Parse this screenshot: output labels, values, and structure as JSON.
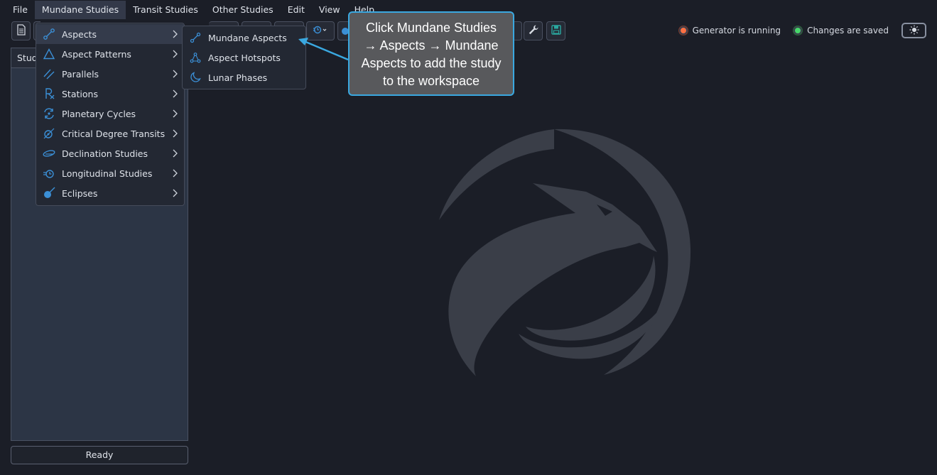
{
  "menubar": {
    "items": [
      {
        "label": "File"
      },
      {
        "label": "Mundane Studies"
      },
      {
        "label": "Transit Studies"
      },
      {
        "label": "Other Studies"
      },
      {
        "label": "Edit"
      },
      {
        "label": "View"
      },
      {
        "label": "Help"
      }
    ]
  },
  "toolbar": {
    "buttons": [
      {
        "icon": "document-icon"
      },
      {
        "icon": "wrench-icon"
      },
      {
        "icon": "save-icon"
      },
      {
        "icon": "longitudinal-icon"
      }
    ]
  },
  "status": {
    "generator": {
      "label": "Generator is running",
      "color": "#ff7043"
    },
    "saved": {
      "label": "Changes are saved",
      "color": "#47d76a"
    },
    "theme_icon": "sun-icon"
  },
  "left_panel": {
    "header": "Stud"
  },
  "ready": {
    "label": "Ready"
  },
  "dropdown": {
    "items": [
      {
        "label": "Aspects",
        "icon": "aspects-icon"
      },
      {
        "label": "Aspect Patterns",
        "icon": "triangle-icon"
      },
      {
        "label": "Parallels",
        "icon": "parallels-icon"
      },
      {
        "label": "Stations",
        "icon": "stations-icon"
      },
      {
        "label": "Planetary Cycles",
        "icon": "cycles-icon"
      },
      {
        "label": "Critical Degree Transits",
        "icon": "critical-degree-icon"
      },
      {
        "label": "Declination Studies",
        "icon": "declination-icon"
      },
      {
        "label": "Longitudinal Studies",
        "icon": "longitudinal-icon"
      },
      {
        "label": "Eclipses",
        "icon": "eclipse-icon"
      }
    ]
  },
  "submenu": {
    "items": [
      {
        "label": "Mundane Aspects",
        "icon": "aspects-icon"
      },
      {
        "label": "Aspect Hotspots",
        "icon": "hotspots-icon"
      },
      {
        "label": "Lunar Phases",
        "icon": "moon-icon"
      }
    ]
  },
  "callout": {
    "text": "Click Mundane Studies\n→ Aspects → Mundane\nAspects to add the study\nto the workspace"
  },
  "colors": {
    "accent": "#3aa8e0",
    "icon_blue": "#3b8fd6",
    "background": "#1b1e27"
  }
}
